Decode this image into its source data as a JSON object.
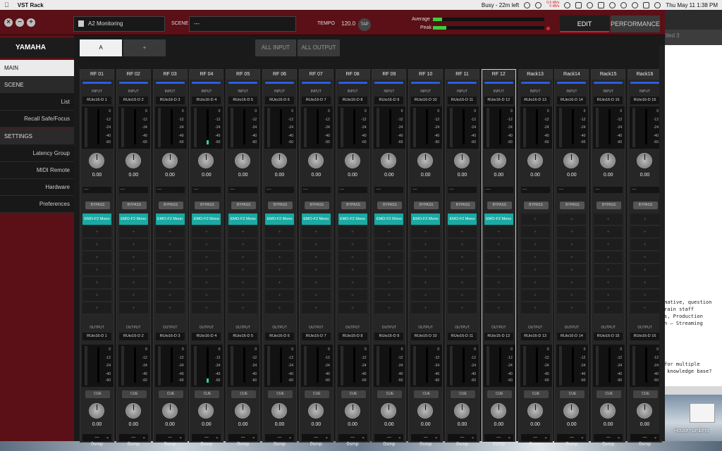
{
  "menubar": {
    "app": "VST Rack",
    "busy": "Busy - 22m left",
    "net_up": "0.6 kB/s",
    "net_down": "0 kB/s",
    "datetime": "Thu May 11  1:38 PM"
  },
  "header": {
    "scene_name": "A2 Monitoring",
    "scene_label": "SCENE",
    "scene_value": "---",
    "tempo_label": "TEMPO",
    "tempo_value": "120.0",
    "tap_label": "TAP",
    "average_label": "Average",
    "peak_label": "Peak",
    "average_level": 0.08,
    "peak_level": 0.12,
    "edit_label": "EDIT",
    "performance_label": "PERFORMANCE"
  },
  "sidebar": {
    "logo": "YAMAHA",
    "main": "MAIN",
    "scene": "SCENE",
    "list": "List",
    "recall": "Recall Safe/Focus",
    "settings": "SETTINGS",
    "latency": "Latency Group",
    "midi": "MIDI Remote",
    "hardware": "Hardware",
    "preferences": "Preferences"
  },
  "tabs": {
    "a": "A",
    "add": "+",
    "all_input": "ALL INPUT",
    "all_output": "ALL OUTPUT"
  },
  "strip_labels": {
    "input": "INPUT",
    "output": "OUTPUT",
    "bypass": "BYPASS",
    "cue": "CUE",
    "plus": "+",
    "dots": "----",
    "delay_sel": "---"
  },
  "channels": [
    {
      "name": "RF 01",
      "in": "RUio16-D 1",
      "out": "RUio16-D 1",
      "vol": "0.00",
      "out_vol": "0.00",
      "plugin": "EMO-F2 Mono",
      "delay": "0smp"
    },
    {
      "name": "RF 02",
      "in": "RUio16-D 2",
      "out": "RUio16-D 2",
      "vol": "0.00",
      "out_vol": "0.00",
      "plugin": "EMO-F2 Mono",
      "delay": "0smp"
    },
    {
      "name": "RF 03",
      "in": "RUio16-D 3",
      "out": "RUio16-D 3",
      "vol": "0.00",
      "out_vol": "0.00",
      "plugin": "EMO-F2 Mono",
      "delay": "0smp"
    },
    {
      "name": "RF 04",
      "in": "RUio16-D 4",
      "out": "RUio16-D 4",
      "vol": "0.00",
      "out_vol": "0.00",
      "plugin": "EMO-F2 Mono",
      "delay": "0smp",
      "in_level": 0.12,
      "out_level": 0.12
    },
    {
      "name": "RF 05",
      "in": "RUio16-D 5",
      "out": "RUio16-D 5",
      "vol": "0.00",
      "out_vol": "0.00",
      "plugin": "EMO-F2 Mono",
      "delay": "0smp"
    },
    {
      "name": "RF 06",
      "in": "RUio16-D 6",
      "out": "RUio16-D 6",
      "vol": "0.00",
      "out_vol": "0.00",
      "plugin": "EMO-F2 Mono",
      "delay": "0smp"
    },
    {
      "name": "RF 07",
      "in": "RUio16-D 7",
      "out": "RUio16-D 7",
      "vol": "0.00",
      "out_vol": "0.00",
      "plugin": "EMO-F2 Mono",
      "delay": "0smp"
    },
    {
      "name": "RF 08",
      "in": "RUio16-D 8",
      "out": "RUio16-D 8",
      "vol": "0.00",
      "out_vol": "0.00",
      "plugin": "EMO-F2 Mono",
      "delay": "0smp"
    },
    {
      "name": "RF 09",
      "in": "RUio16-D 9",
      "out": "RUio16-D 9",
      "vol": "0.00",
      "out_vol": "0.00",
      "plugin": "EMO-F2 Mono",
      "delay": "0smp"
    },
    {
      "name": "RF 10",
      "in": "RUio16-D 10",
      "out": "RUio16-D 10",
      "vol": "0.00",
      "out_vol": "0.00",
      "plugin": "EMO-F2 Mono",
      "delay": "0smp"
    },
    {
      "name": "RF 11",
      "in": "RUio16-D 11",
      "out": "RUio16-D 11",
      "vol": "0.00",
      "out_vol": "0.00",
      "plugin": "EMO-F2 Mono",
      "delay": "0smp"
    },
    {
      "name": "RF 12",
      "in": "RUio16-D 12",
      "out": "RUio16-D 12",
      "vol": "0.00",
      "out_vol": "0.00",
      "plugin": "EMO-F2 Mono",
      "delay": "0smp",
      "selected": true
    },
    {
      "name": "Rack13",
      "in": "RUio16-D 13",
      "out": "RUio16-D 13",
      "vol": "0.00",
      "out_vol": "0.00",
      "delay": "0smp"
    },
    {
      "name": "Rack14",
      "in": "RUio16-D 14",
      "out": "RUio16-D 14",
      "vol": "0.00",
      "out_vol": "0.00",
      "delay": "0smp"
    },
    {
      "name": "Rack15",
      "in": "RUio16-D 15",
      "out": "RUio16-D 15",
      "vol": "0.00",
      "out_vol": "0.00",
      "delay": "0smp"
    },
    {
      "name": "Rack16",
      "in": "RUio16-D 16",
      "out": "RUio16-D 16",
      "vol": "0.00",
      "out_vol": "0.00",
      "delay": "0smp"
    }
  ],
  "scale": [
    "0",
    "-12",
    "-24",
    "-40",
    "-60"
  ],
  "background": {
    "tab": "tled 3",
    "lines": [
      "mative, question",
      "rain staff",
      "s, Production",
      "n – Streaming"
    ],
    "lines2": [
      "for multiple",
      " knowledge base?"
    ],
    "house": "House numbers"
  },
  "colors": {
    "accent": "#5a1016",
    "plugin": "#1aa9a3",
    "meter": "#3bd03b"
  }
}
